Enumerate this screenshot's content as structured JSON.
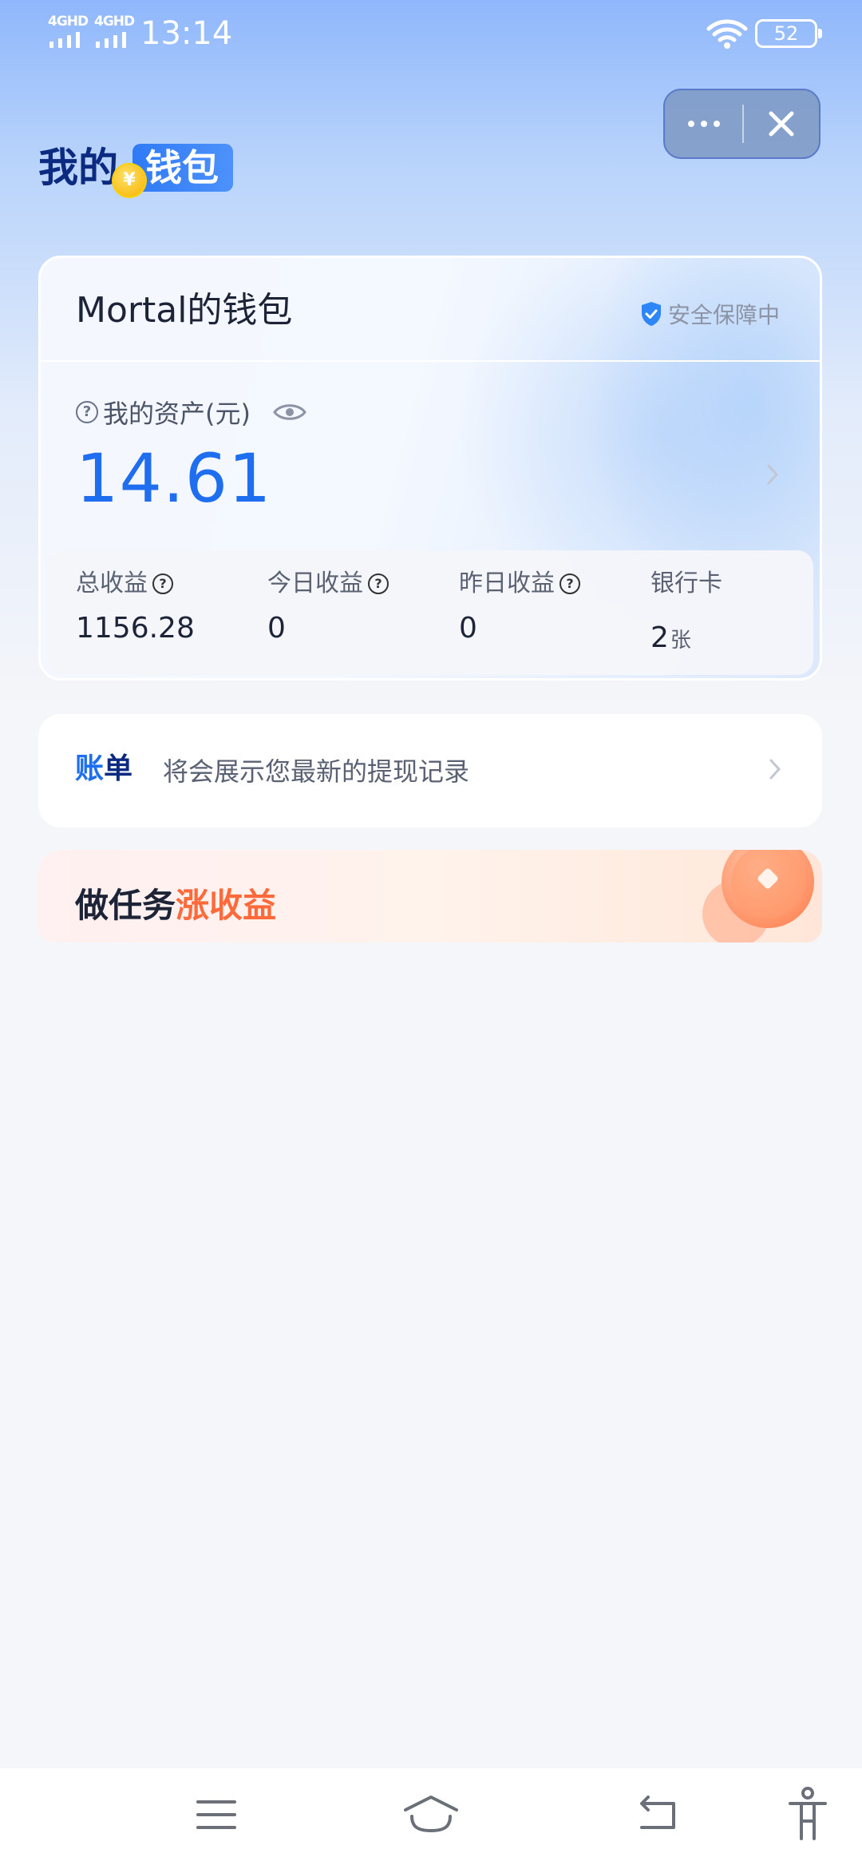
{
  "status_bar": {
    "signal_1": "4GHD",
    "signal_2": "4GHD",
    "time": "13:14",
    "battery": "52"
  },
  "header": {
    "title_part1": "我的",
    "title_part2": "钱包",
    "coin_symbol": "¥"
  },
  "wallet": {
    "owner": "Mortal的钱包",
    "safety_badge": "安全保障中",
    "assets_label": "我的资产(元)",
    "assets_value": "14.61",
    "stats": [
      {
        "label": "总收益",
        "value": "1156.28"
      },
      {
        "label": "今日收益",
        "value": "0"
      },
      {
        "label": "昨日收益",
        "value": "0"
      },
      {
        "label": "银行卡",
        "value": "2",
        "unit": "张"
      }
    ]
  },
  "bill": {
    "brand_1": "账",
    "brand_2": "单",
    "text": "将会展示您最新的提现记录"
  },
  "task": {
    "title_part1": "做任务",
    "title_part2": "涨收益"
  },
  "colors": {
    "accent_blue": "#1f6ef0",
    "brand_navy": "#0b2a80",
    "task_orange": "#ff6a3a"
  },
  "icons": [
    "more-icon",
    "close-icon",
    "shield-check-icon",
    "help-icon",
    "eye-icon",
    "chevron-right-icon",
    "menu-icon",
    "home-icon",
    "back-icon",
    "accessibility-icon"
  ]
}
